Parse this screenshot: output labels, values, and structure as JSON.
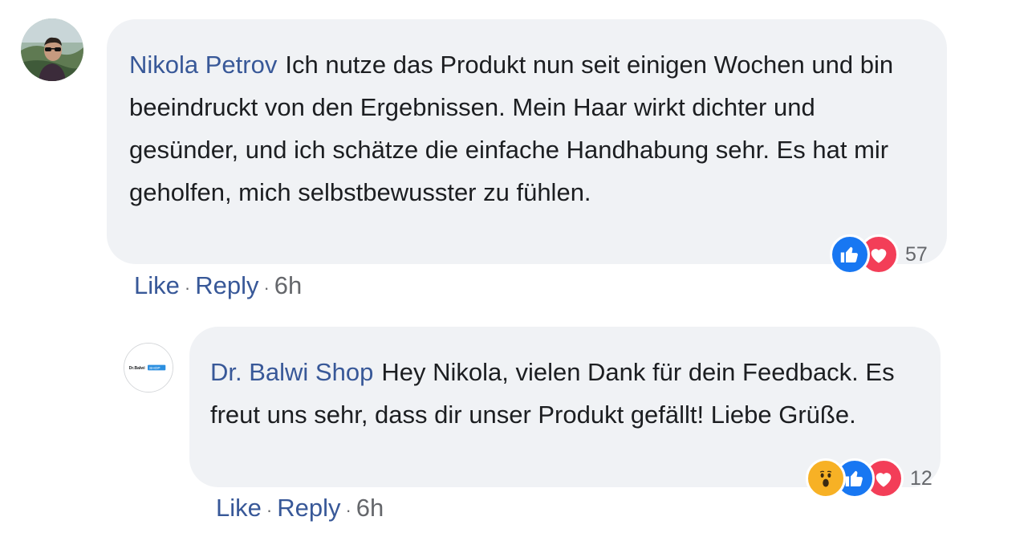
{
  "comments": [
    {
      "author": "Nikola Petrov",
      "text": "Ich nutze das Produkt nun seit einigen Wochen und bin beeindruckt von den Ergebnissen. Mein Haar wirkt dichter und gesünder, und ich schätze die einfache Handhabung sehr. Es hat mir geholfen, mich selbstbewusster zu fühlen.",
      "reactions": [
        "like-icon",
        "love-icon"
      ],
      "reaction_count": "57",
      "actions": {
        "like": "Like",
        "reply": "Reply",
        "separator": "·",
        "time": "6h"
      }
    },
    {
      "author": "Dr. Balwi Shop",
      "avatar_logo_text": "Dr.Balwi SHOP",
      "text": "Hey Nikola, vielen Dank für dein Feedback. Es freut uns sehr, dass dir unser Produkt gefällt! Liebe Grüße.",
      "reactions": [
        "wow-icon",
        "like-icon",
        "love-icon"
      ],
      "reaction_count": "12",
      "actions": {
        "like": "Like",
        "reply": "Reply",
        "separator": "·",
        "time": "6h"
      }
    }
  ],
  "colors": {
    "author_link": "#385898",
    "bubble_bg": "#f0f2f5",
    "like_blue": "#1877f2",
    "love_red": "#f33e58",
    "wow_yellow": "#f7b125",
    "meta_gray": "#65676b"
  }
}
